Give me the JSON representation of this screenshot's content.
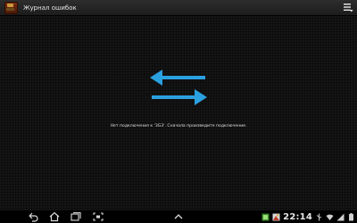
{
  "action_bar": {
    "title": "Журнал ошибок",
    "app_icon": "chest-icon",
    "menu_icon": "overflow-menu-icon"
  },
  "main": {
    "icon": "sync-arrows-icon",
    "icon_color": "#2aa0e0",
    "message": "Нет подключения к '3G3'. Сначала произведите подключение."
  },
  "system_bar": {
    "nav_buttons": [
      "back-icon",
      "home-icon",
      "recent-apps-icon",
      "screenshot-icon"
    ],
    "center_icon": "chevron-up-icon",
    "time": "22:14",
    "status_icons": [
      "notification-icon",
      "picture-icon",
      "usb-icon",
      "wifi-icon",
      "signal-icon",
      "battery-icon"
    ]
  }
}
